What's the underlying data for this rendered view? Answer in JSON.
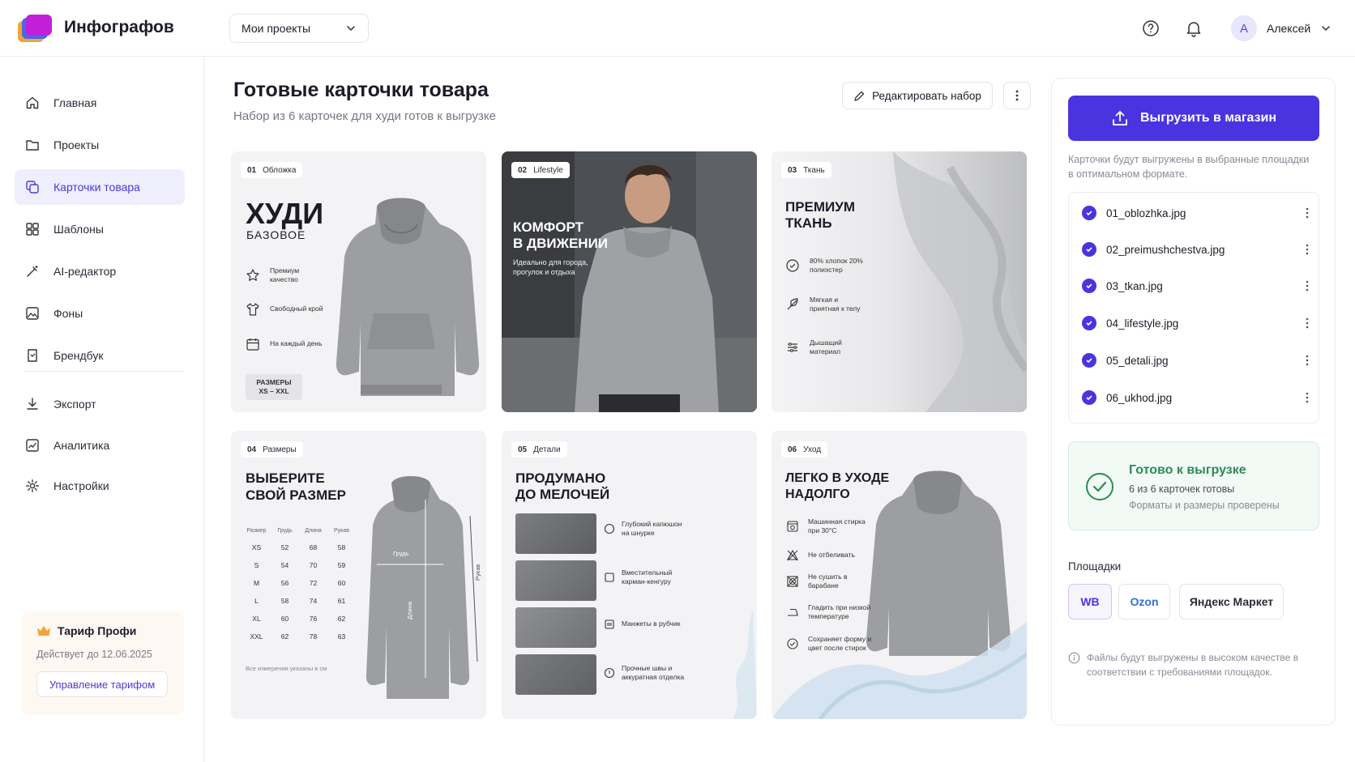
{
  "app": {
    "name": "Инфографов"
  },
  "header": {
    "project_select": "Мои проекты",
    "user": {
      "initial": "А",
      "name": "Алексей"
    }
  },
  "sidebar": {
    "items": [
      {
        "label": "Главная",
        "icon": "home-icon"
      },
      {
        "label": "Проекты",
        "icon": "folder-icon"
      },
      {
        "label": "Карточки товара",
        "icon": "cards-icon",
        "active": true
      },
      {
        "label": "Шаблоны",
        "icon": "grid-icon"
      },
      {
        "label": "AI-редактор",
        "icon": "magic-wand-icon"
      },
      {
        "label": "Фоны",
        "icon": "image-icon"
      },
      {
        "label": "Брендбук",
        "icon": "brand-book-icon"
      },
      {
        "label": "Экспорт",
        "icon": "download-icon"
      },
      {
        "label": "Аналитика",
        "icon": "chart-icon"
      },
      {
        "label": "Настройки",
        "icon": "gear-icon"
      }
    ],
    "plan": {
      "title": "Тариф Профи",
      "valid_until": "Действует до 12.06.2025",
      "manage": "Управление тарифом"
    }
  },
  "main": {
    "title": "Готовые карточки товара",
    "subtitle": "Набор из 6 карточек для худи готов к выгрузке",
    "edit_button": "Редактировать набор"
  },
  "cards": [
    {
      "num": "01",
      "tag": "Обложка",
      "title": "ХУДИ",
      "subtitle": "БАЗОВОЕ",
      "features": [
        "Премиум качество",
        "Свободный крой",
        "На каждый день"
      ],
      "badge_line1": "РАЗМЕРЫ",
      "badge_line2": "XS – XXL"
    },
    {
      "num": "02",
      "tag": "Lifestyle",
      "title_line1": "КОМФОРТ",
      "title_line2": "В ДВИЖЕНИИ",
      "text": "Идеально для города, прогулок и отдыха"
    },
    {
      "num": "03",
      "tag": "Ткань",
      "title_line1": "ПРЕМИУМ",
      "title_line2": "ТКАНЬ",
      "features": [
        "80% хлопок 20% полиэстер",
        "Мягкая и приятная к телу",
        "Дышащий материал"
      ]
    },
    {
      "num": "04",
      "tag": "Размеры",
      "title_line1": "ВЫБЕРИТЕ",
      "title_line2": "СВОЙ РАЗМЕР",
      "table_headers": [
        "Размер",
        "Грудь",
        "Длина",
        "Рукав"
      ],
      "table_rows": [
        [
          "XS",
          "52",
          "68",
          "58"
        ],
        [
          "S",
          "54",
          "70",
          "59"
        ],
        [
          "M",
          "56",
          "72",
          "60"
        ],
        [
          "L",
          "58",
          "74",
          "61"
        ],
        [
          "XL",
          "60",
          "76",
          "62"
        ],
        [
          "XXL",
          "62",
          "78",
          "63"
        ]
      ],
      "note": "Все измерения указаны в см",
      "chest_label": "Грудь",
      "length_label": "Длина",
      "sleeve_label": "Рукав"
    },
    {
      "num": "05",
      "tag": "Детали",
      "title_line1": "ПРОДУМАНО",
      "title_line2": "ДО МЕЛОЧЕЙ",
      "features": [
        "Глубокий капюшон на шнурке",
        "Вместительный карман-кенгуру",
        "Манжеты в рубчик",
        "Прочные швы и аккуратная отделка"
      ]
    },
    {
      "num": "06",
      "tag": "Уход",
      "title_line1": "ЛЕГКО В УХОДЕ",
      "title_line2": "НАДОЛГО",
      "features": [
        "Машинная стирка при 30°C",
        "Не отбеливать",
        "Не сушить в барабане",
        "Гладить при низкой температуре",
        "Сохраняет форму и цвет после стирок"
      ]
    }
  ],
  "right_panel": {
    "upload_button": "Выгрузить в магазин",
    "upload_note": "Карточки будут выгружены в выбранные площадки в оптимальном формате.",
    "files": [
      "01_oblozhka.jpg",
      "02_preimushchestva.jpg",
      "03_tkan.jpg",
      "04_lifestyle.jpg",
      "05_detali.jpg",
      "06_ukhod.jpg"
    ],
    "ready": {
      "title": "Готово к выгрузке",
      "line1": "6 из 6 карточек готовы",
      "line2": "Форматы и размеры проверены"
    },
    "markets_title": "Площадки",
    "markets": [
      "WB",
      "Ozon",
      "Яндекс Маркет"
    ],
    "final_note": "Файлы будут выгружены в высоком качестве в соответствии с требованиями площадок."
  },
  "colors": {
    "accent": "#4a34e0",
    "success": "#2e8a55",
    "active_bg": "#efeefc"
  }
}
